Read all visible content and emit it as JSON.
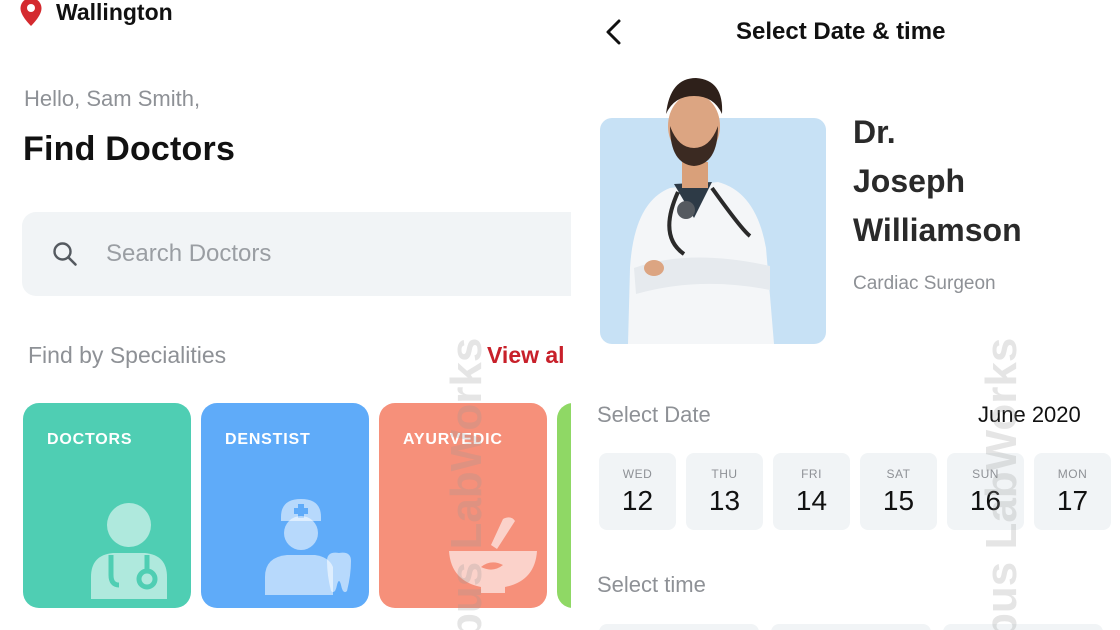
{
  "left": {
    "location": {
      "icon": "map-pin-icon",
      "label": "Wallington"
    },
    "greeting": "Hello, Sam Smith,",
    "title": "Find Doctors",
    "search": {
      "icon": "search-icon",
      "placeholder": "Search Doctors",
      "value": ""
    },
    "specialities": {
      "label": "Find by Specialities",
      "view_all": "View al",
      "cards": [
        {
          "label": "DOCTORS",
          "icon": "doctor-icon",
          "color": "#4fceb3"
        },
        {
          "label": "DENSTIST",
          "icon": "dentist-icon",
          "color": "#5fabf9"
        },
        {
          "label": "AYURVEDIC",
          "icon": "mortar-pestle-icon",
          "color": "#f6907a"
        },
        {
          "label": "",
          "icon": "",
          "color": "#8fd865"
        }
      ]
    }
  },
  "right": {
    "back_icon": "chevron-left-icon",
    "title": "Select Date & time",
    "doctor": {
      "name_lines": [
        "Dr.",
        "Joseph",
        "Williamson"
      ],
      "role": "Cardiac Surgeon",
      "photo_bg": "#c7e1f5"
    },
    "date": {
      "label": "Select Date",
      "month": "June 2020",
      "days": [
        {
          "name": "WED",
          "num": "12"
        },
        {
          "name": "THU",
          "num": "13"
        },
        {
          "name": "FRI",
          "num": "14"
        },
        {
          "name": "SAT",
          "num": "15"
        },
        {
          "name": "SUN",
          "num": "16"
        },
        {
          "name": "MON",
          "num": "17"
        }
      ]
    },
    "time": {
      "label": "Select time"
    }
  },
  "watermark": "pus LabWorks",
  "colors": {
    "accent": "#c8202a",
    "surface": "#f1f4f6",
    "muted": "#8e9196"
  }
}
